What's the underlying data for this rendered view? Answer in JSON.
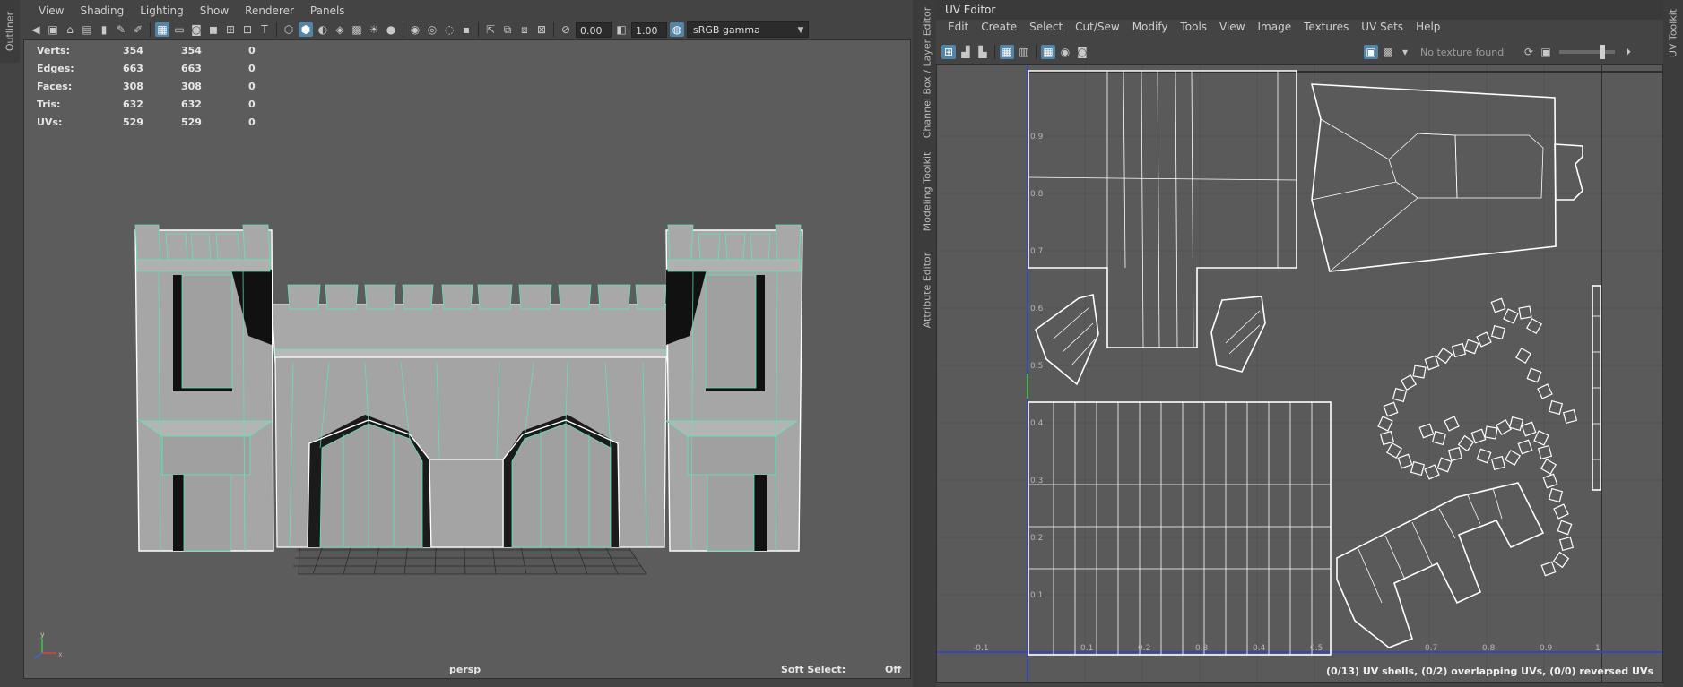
{
  "outliner_tab": "Outliner",
  "viewport": {
    "menu": [
      "View",
      "Shading",
      "Lighting",
      "Show",
      "Renderer",
      "Panels"
    ],
    "toolbar": {
      "exposure": "0.00",
      "gamma": "1.00",
      "color_management": "sRGB gamma"
    },
    "hud": {
      "rows": [
        {
          "label": "Verts:",
          "v1": "354",
          "v2": "354",
          "v3": "0"
        },
        {
          "label": "Edges:",
          "v1": "663",
          "v2": "663",
          "v3": "0"
        },
        {
          "label": "Faces:",
          "v1": "308",
          "v2": "308",
          "v3": "0"
        },
        {
          "label": "Tris:",
          "v1": "632",
          "v2": "632",
          "v3": "0"
        },
        {
          "label": "UVs:",
          "v1": "529",
          "v2": "529",
          "v3": "0"
        }
      ]
    },
    "camera": "persp",
    "soft_select_label": "Soft Select:",
    "soft_select_value": "Off"
  },
  "side_tabs": [
    "Channel Box / Layer Editor",
    "Modeling Toolkit",
    "Attribute Editor"
  ],
  "uv_editor": {
    "title": "UV Editor",
    "menu": [
      "Edit",
      "Create",
      "Select",
      "Cut/Sew",
      "Modify",
      "Tools",
      "View",
      "Image",
      "Textures",
      "UV Sets",
      "Help"
    ],
    "texture_field": "No texture found",
    "status": "(0/13) UV shells, (0/2) overlapping UVs, (0/0) reversed UVs",
    "axis_x": [
      "-0.1",
      "0.1",
      "0.2",
      "0.3",
      "0.4",
      "0.5",
      "0.7",
      "0.8",
      "0.9",
      "1"
    ],
    "axis_y": [
      "0.9",
      "0.8",
      "0.7",
      "0.6",
      "0.5",
      "0.4",
      "0.3",
      "0.2",
      "0.1"
    ]
  },
  "right_tab": "UV Toolkit",
  "colors": {
    "viewport_bg": "#5c5c5c",
    "uv_bg": "#5a5a5a",
    "wire_green": "#5de8b0",
    "selection_blue": "#5285a6"
  }
}
